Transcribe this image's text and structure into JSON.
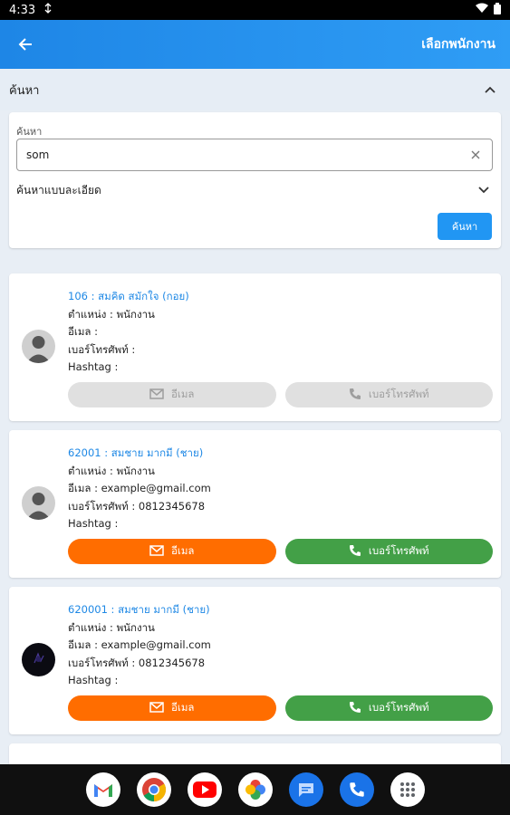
{
  "status": {
    "time": "4:33",
    "sync_icon": "sync-icon",
    "wifi_icon": "wifi-icon",
    "battery_icon": "battery-icon"
  },
  "appbar": {
    "title": "เลือกพนักงาน"
  },
  "search": {
    "section_title": "ค้นหา",
    "field_label": "ค้นหา",
    "value": "som",
    "advanced_label": "ค้นหาแบบละเอียด",
    "search_button": "ค้นหา"
  },
  "employees": [
    {
      "name": "106 : สมคิด สมักใจ (กอย)",
      "position": "ตำแหน่ง : พนักงาน",
      "email": "อีเมล :",
      "phone": "เบอร์โทรศัพท์ :",
      "hashtag": "Hashtag :",
      "email_btn": "อีเมล",
      "phone_btn": "เบอร์โทรศัพท์",
      "enabled": false
    },
    {
      "name": "62001 : สมชาย มากมี (ชาย)",
      "position": "ตำแหน่ง : พนักงาน",
      "email": "อีเมล : example@gmail.com",
      "phone": "เบอร์โทรศัพท์ : 0812345678",
      "hashtag": "Hashtag :",
      "email_btn": "อีเมล",
      "phone_btn": "เบอร์โทรศัพท์",
      "enabled": true
    },
    {
      "name": "620001 : สมชาย มากมี (ชาย)",
      "position": "ตำแหน่ง : พนักงาน",
      "email": "อีเมล : example@gmail.com",
      "phone": "เบอร์โทรศัพท์ : 0812345678",
      "hashtag": "Hashtag :",
      "email_btn": "อีเมล",
      "phone_btn": "เบอร์โทรศัพท์",
      "enabled": true
    }
  ],
  "colors": {
    "primary": "#2196f3",
    "email": "#ff6d00",
    "phone": "#43a047",
    "disabled": "#e0e0e0"
  },
  "dock": [
    "gmail-icon",
    "chrome-icon",
    "youtube-icon",
    "photos-icon",
    "messages-icon",
    "phone-icon",
    "apps-icon"
  ]
}
